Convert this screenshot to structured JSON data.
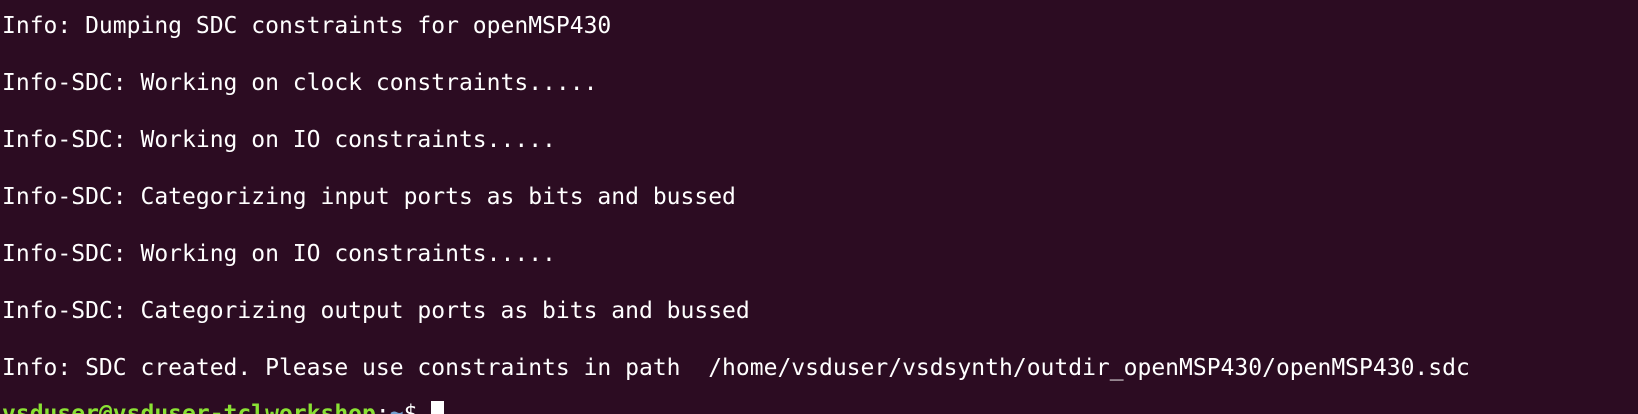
{
  "terminal": {
    "lines": [
      "Info: Dumping SDC constraints for openMSP430",
      "Info-SDC: Working on clock constraints.....",
      "Info-SDC: Working on IO constraints.....",
      "Info-SDC: Categorizing input ports as bits and bussed",
      "Info-SDC: Working on IO constraints.....",
      "Info-SDC: Categorizing output ports as bits and bussed",
      "Info: SDC created. Please use constraints in path  /home/vsduser/vsdsynth/outdir_openMSP430/openMSP430.sdc"
    ],
    "prompt": {
      "user_host": "vsduser@vsduser-tclworkshop",
      "separator": ":",
      "path": "~",
      "symbol": "$ "
    }
  },
  "colors": {
    "background": "#2c0c22",
    "text": "#ffffff",
    "prompt_user": "#8ae234",
    "prompt_path": "#729fcf"
  }
}
